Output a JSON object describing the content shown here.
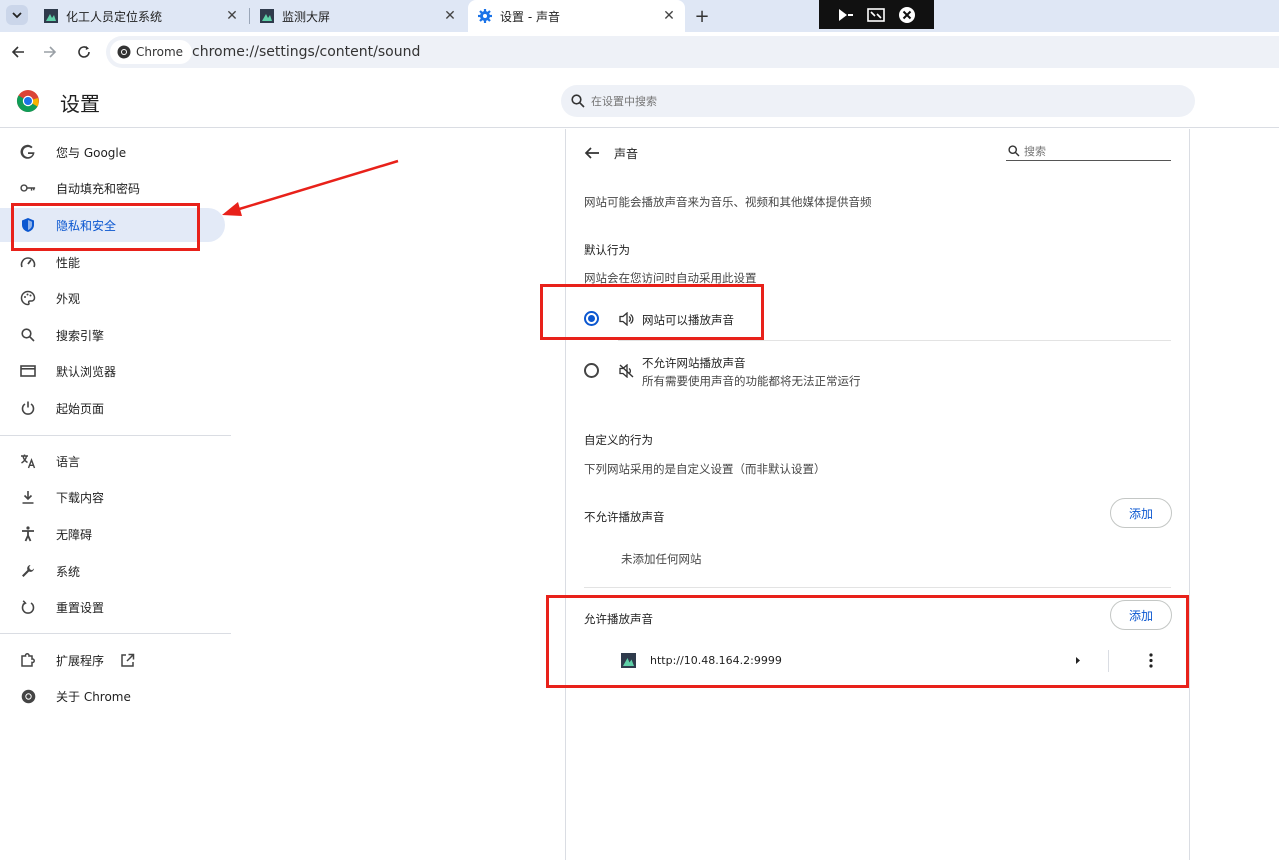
{
  "tabs": [
    {
      "title": "化工人员定位系统",
      "active": false
    },
    {
      "title": "监测大屏",
      "active": false
    },
    {
      "title": "设置 - 声音",
      "active": true
    }
  ],
  "omnibox": {
    "chip_label": "Chrome",
    "url": "chrome://settings/content/sound"
  },
  "header": {
    "title": "设置",
    "search_placeholder": "在设置中搜索"
  },
  "sidebar": {
    "items": [
      {
        "label": "您与 Google",
        "icon": "google-g-icon"
      },
      {
        "label": "自动填充和密码",
        "icon": "key-icon"
      },
      {
        "label": "隐私和安全",
        "icon": "shield-icon",
        "active": true
      },
      {
        "label": "性能",
        "icon": "speedometer-icon"
      },
      {
        "label": "外观",
        "icon": "palette-icon"
      },
      {
        "label": "搜索引擎",
        "icon": "search-icon"
      },
      {
        "label": "默认浏览器",
        "icon": "browser-window-icon"
      },
      {
        "label": "起始页面",
        "icon": "power-icon"
      },
      {
        "label": "语言",
        "icon": "translate-icon"
      },
      {
        "label": "下载内容",
        "icon": "download-icon"
      },
      {
        "label": "无障碍",
        "icon": "accessibility-icon"
      },
      {
        "label": "系统",
        "icon": "wrench-icon"
      },
      {
        "label": "重置设置",
        "icon": "reset-icon"
      },
      {
        "label": "扩展程序",
        "icon": "puzzle-icon"
      },
      {
        "label": "关于 Chrome",
        "icon": "chrome-icon"
      }
    ]
  },
  "content": {
    "page_title": "声音",
    "search_placeholder": "搜索",
    "description": "网站可能会播放声音来为音乐、视频和其他媒体提供音频",
    "default_behavior": {
      "heading": "默认行为",
      "subheading": "网站会在您访问时自动采用此设置",
      "options": [
        {
          "label": "网站可以播放声音",
          "selected": true
        },
        {
          "label": "不允许网站播放声音",
          "sublabel": "所有需要使用声音的功能都将无法正常运行",
          "selected": false
        }
      ]
    },
    "custom_behavior": {
      "heading": "自定义的行为",
      "subheading": "下列网站采用的是自定义设置（而非默认设置）"
    },
    "block_list": {
      "heading": "不允许播放声音",
      "add_label": "添加",
      "empty_text": "未添加任何网站"
    },
    "allow_list": {
      "heading": "允许播放声音",
      "add_label": "添加",
      "sites": [
        "http://10.48.164.2:9999"
      ]
    }
  },
  "colors": {
    "accent": "#0b57d0",
    "annotation_red": "#e8211a",
    "tabstrip": "#dfe7f5"
  }
}
